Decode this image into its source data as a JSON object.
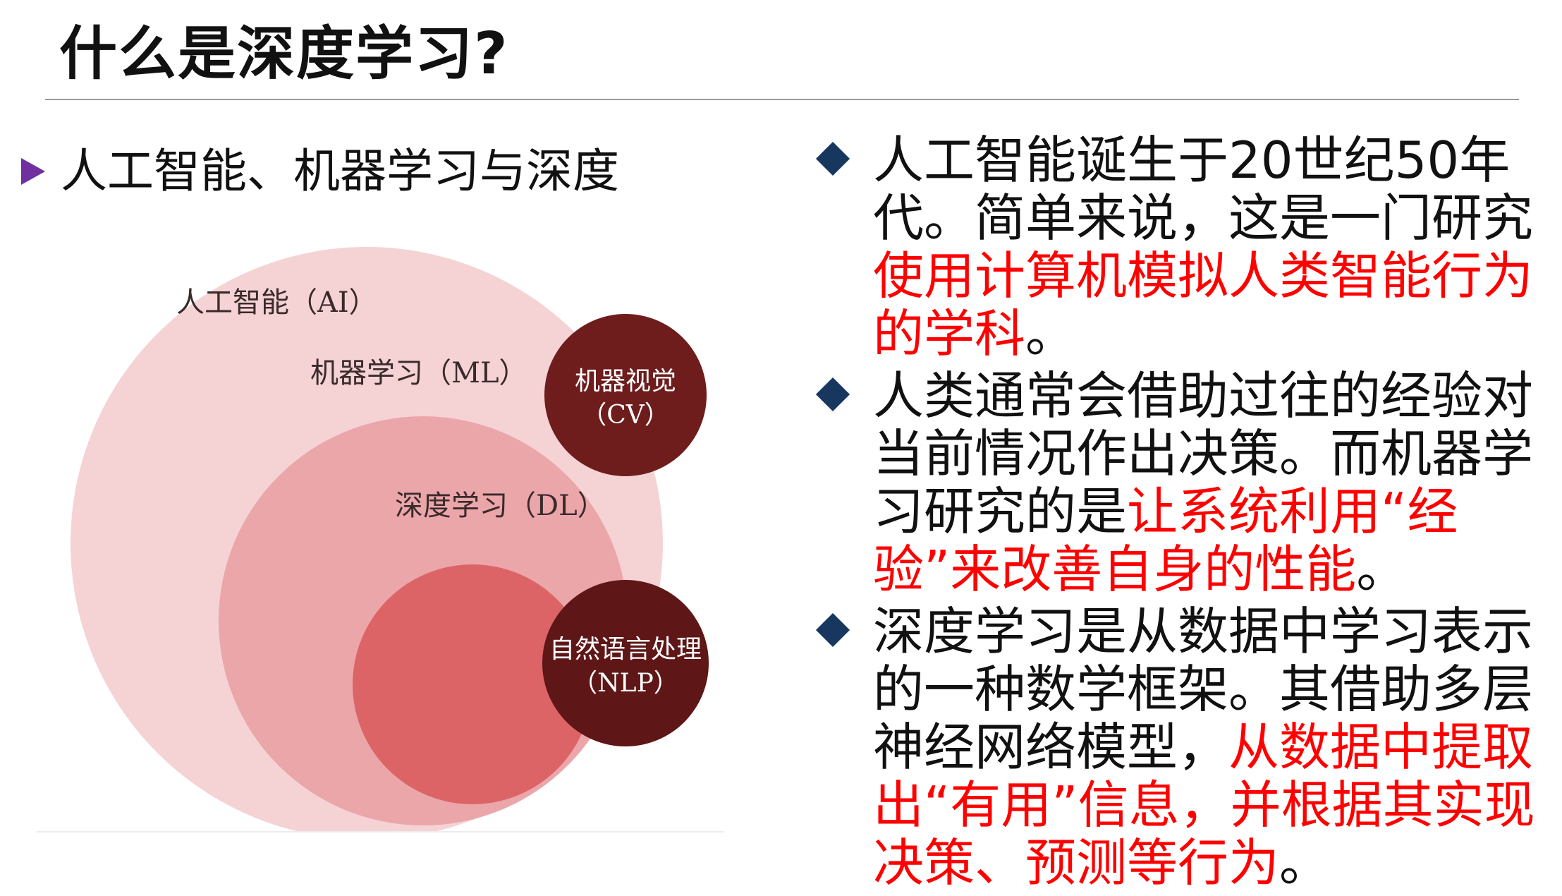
{
  "title": "什么是深度学习?",
  "subheading": "人工智能、机器学习与深度",
  "diagram": {
    "ai_label": "人工智能（AI）",
    "ml_label": "机器学习（ML）",
    "dl_label": "深度学习（DL）",
    "cv_label_line1": "机器视觉",
    "cv_label_line2": "（CV）",
    "nlp_label_line1": "自然语言处理",
    "nlp_label_line2": "（NLP）",
    "colors": {
      "ai": "#f5d3d5",
      "ml": "#eba6aa",
      "dl": "#dc6467",
      "dark": "#6e1c1c"
    }
  },
  "bullets": [
    {
      "plain1": "人工智能诞生于20世纪50年代。简单来说，这是一门研究",
      "red": "使用计算机模拟人类智能行为的学科",
      "plain2": "。"
    },
    {
      "plain1": "人类通常会借助过往的经验对当前情况作出决策。而机器学习研究的是",
      "red": "让系统利用“经验”来改善自身的性能",
      "plain2": "。"
    },
    {
      "plain1": "深度学习是从数据中学习表示的一种数学框架。其借助多层神经网络模型，",
      "red": "从数据中提取出“有用”信息，并根据其实现决策、预测等行为",
      "plain2": "。"
    }
  ]
}
